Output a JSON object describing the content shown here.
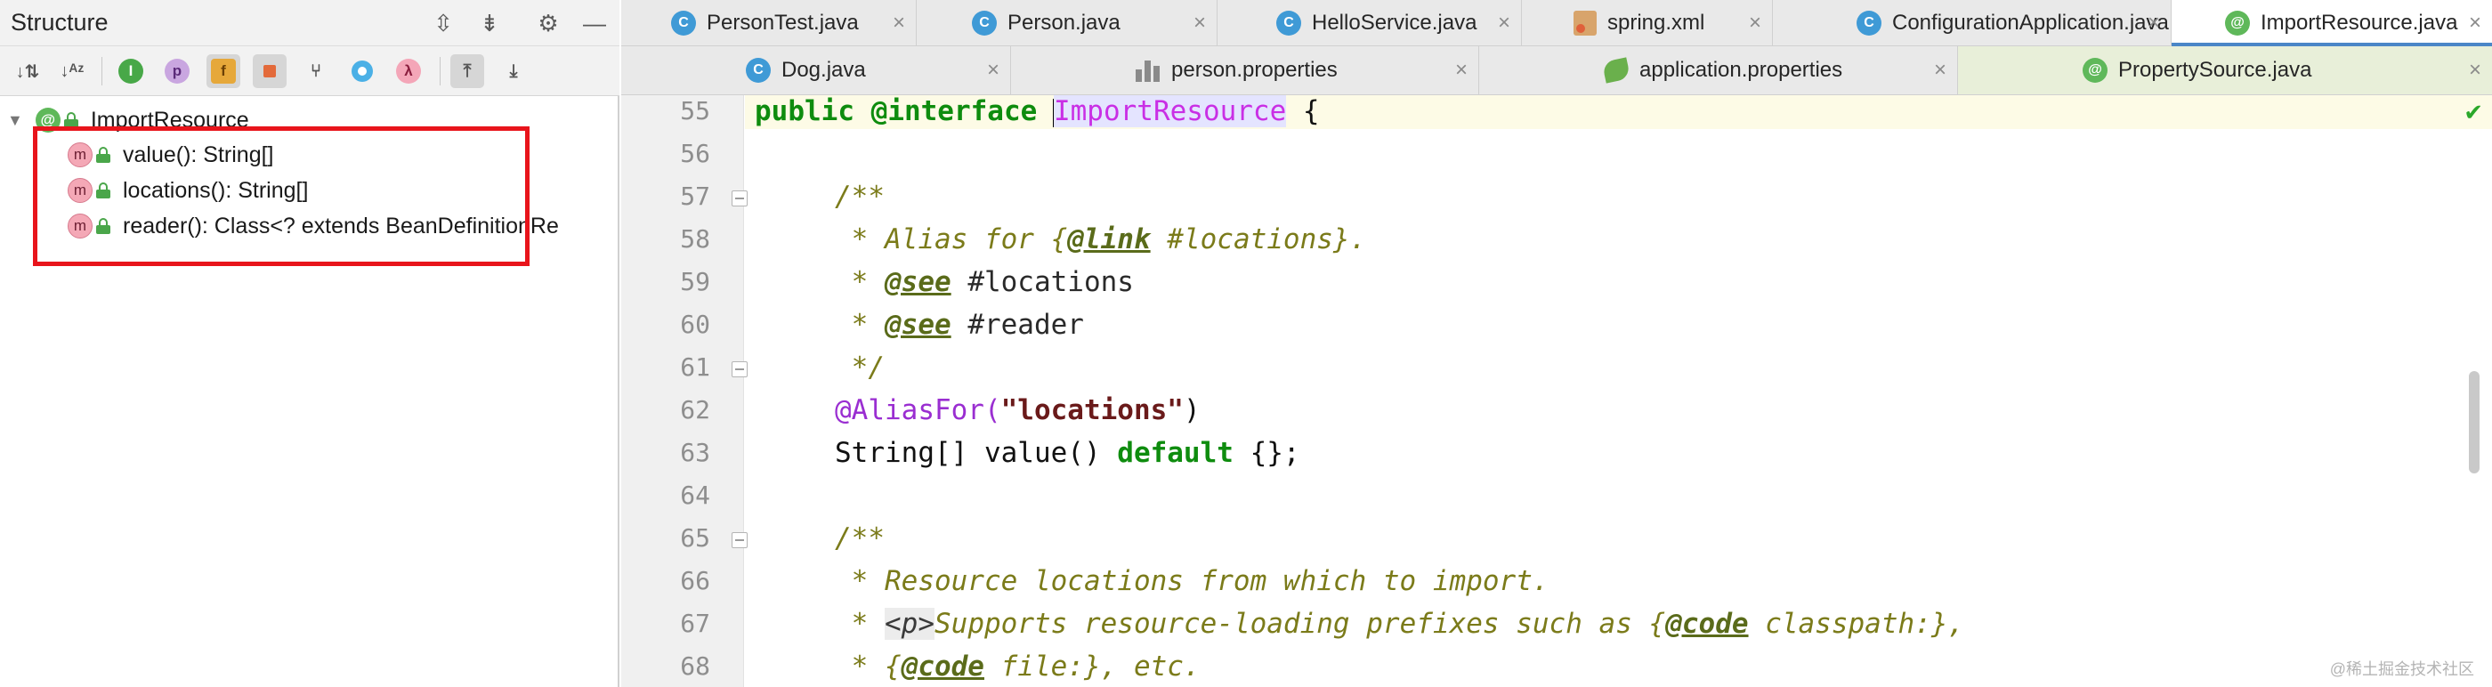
{
  "structure": {
    "title": "Structure",
    "header_buttons": [
      "expand-all-icon",
      "collapse-all-icon",
      "gear-icon",
      "minimize-icon"
    ],
    "toolbar": [
      "sort-by-visibility-icon",
      "sort-alphabetically-icon",
      "show-inherited-icon",
      "show-properties-icon",
      "show-fields-icon",
      "show-non-public-icon",
      "show-hierarchy-icon",
      "show-anonymous-icon",
      "show-lambdas-icon",
      "autoscroll-to-source-icon",
      "autoscroll-from-source-icon"
    ],
    "toolbar_glyphs": {
      "properties": "p",
      "fields": "f",
      "lambdas": "λ",
      "inherited": "I"
    },
    "root": {
      "badge": "@",
      "label": "ImportResource"
    },
    "items": [
      {
        "badge": "m",
        "label": "value(): String[]"
      },
      {
        "badge": "m",
        "label": "locations(): String[]"
      },
      {
        "badge": "m",
        "label": "reader(): Class<? extends BeanDefinitionRe"
      }
    ]
  },
  "tabs_row1": [
    {
      "label": "PersonTest.java",
      "icon": "class-icon",
      "badge": "C"
    },
    {
      "label": "Person.java",
      "icon": "class-icon",
      "badge": "C"
    },
    {
      "label": "HelloService.java",
      "icon": "class-icon",
      "badge": "C"
    },
    {
      "label": "spring.xml",
      "icon": "xml-icon"
    },
    {
      "label": "ConfigurationApplication.java",
      "icon": "class-icon",
      "badge": "C"
    },
    {
      "label": "ImportResource.java",
      "icon": "annotation-icon",
      "badge": "@",
      "active": true
    }
  ],
  "tabs_row2": [
    {
      "label": "Dog.java",
      "icon": "class-icon",
      "badge": "C"
    },
    {
      "label": "person.properties",
      "icon": "properties-icon"
    },
    {
      "label": "application.properties",
      "icon": "spring-leaf-icon"
    },
    {
      "label": "PropertySource.java",
      "icon": "annotation-icon",
      "badge": "@"
    }
  ],
  "close_glyph": "×",
  "editor": {
    "line_numbers": [
      "55",
      "56",
      "57",
      "58",
      "59",
      "60",
      "61",
      "62",
      "63",
      "64",
      "65",
      "66",
      "67",
      "68"
    ],
    "code": {
      "l55_a": "public @",
      "l55_b": "interface",
      "l55_c": " ",
      "l55_d": "ImportResource",
      "l55_e": " {",
      "l57": "/**",
      "l58_a": " * Alias for {",
      "l58_b": "@link",
      "l58_c": " #locations}.",
      "l59_a": " * ",
      "l59_b": "@see",
      "l59_c": " #locations",
      "l60_a": " * ",
      "l60_b": "@see",
      "l60_c": " #reader",
      "l61": " */",
      "l62_a": "@AliasFor(",
      "l62_b": "\"locations\"",
      "l62_c": ")",
      "l63_a": "String[] value() ",
      "l63_b": "default",
      "l63_c": " {};",
      "l65": "/**",
      "l66": " * Resource locations from which to import.",
      "l67_a": " * ",
      "l67_b": "<p>",
      "l67_c": "Supports resource-loading prefixes such as {",
      "l67_d": "@code",
      "l67_e": " classpath:},",
      "l68_a": " * {",
      "l68_b": "@code",
      "l68_c": " file:}, etc."
    },
    "status_icon": "✔"
  },
  "watermark": "@稀土掘金技术社区",
  "colors": {
    "keyword": "#0e8c0e",
    "annotation": "#9a2ed1",
    "comment": "#7b7b1a",
    "highlight_box": "#e8141b",
    "active_tab_underline": "#4a86c7"
  }
}
